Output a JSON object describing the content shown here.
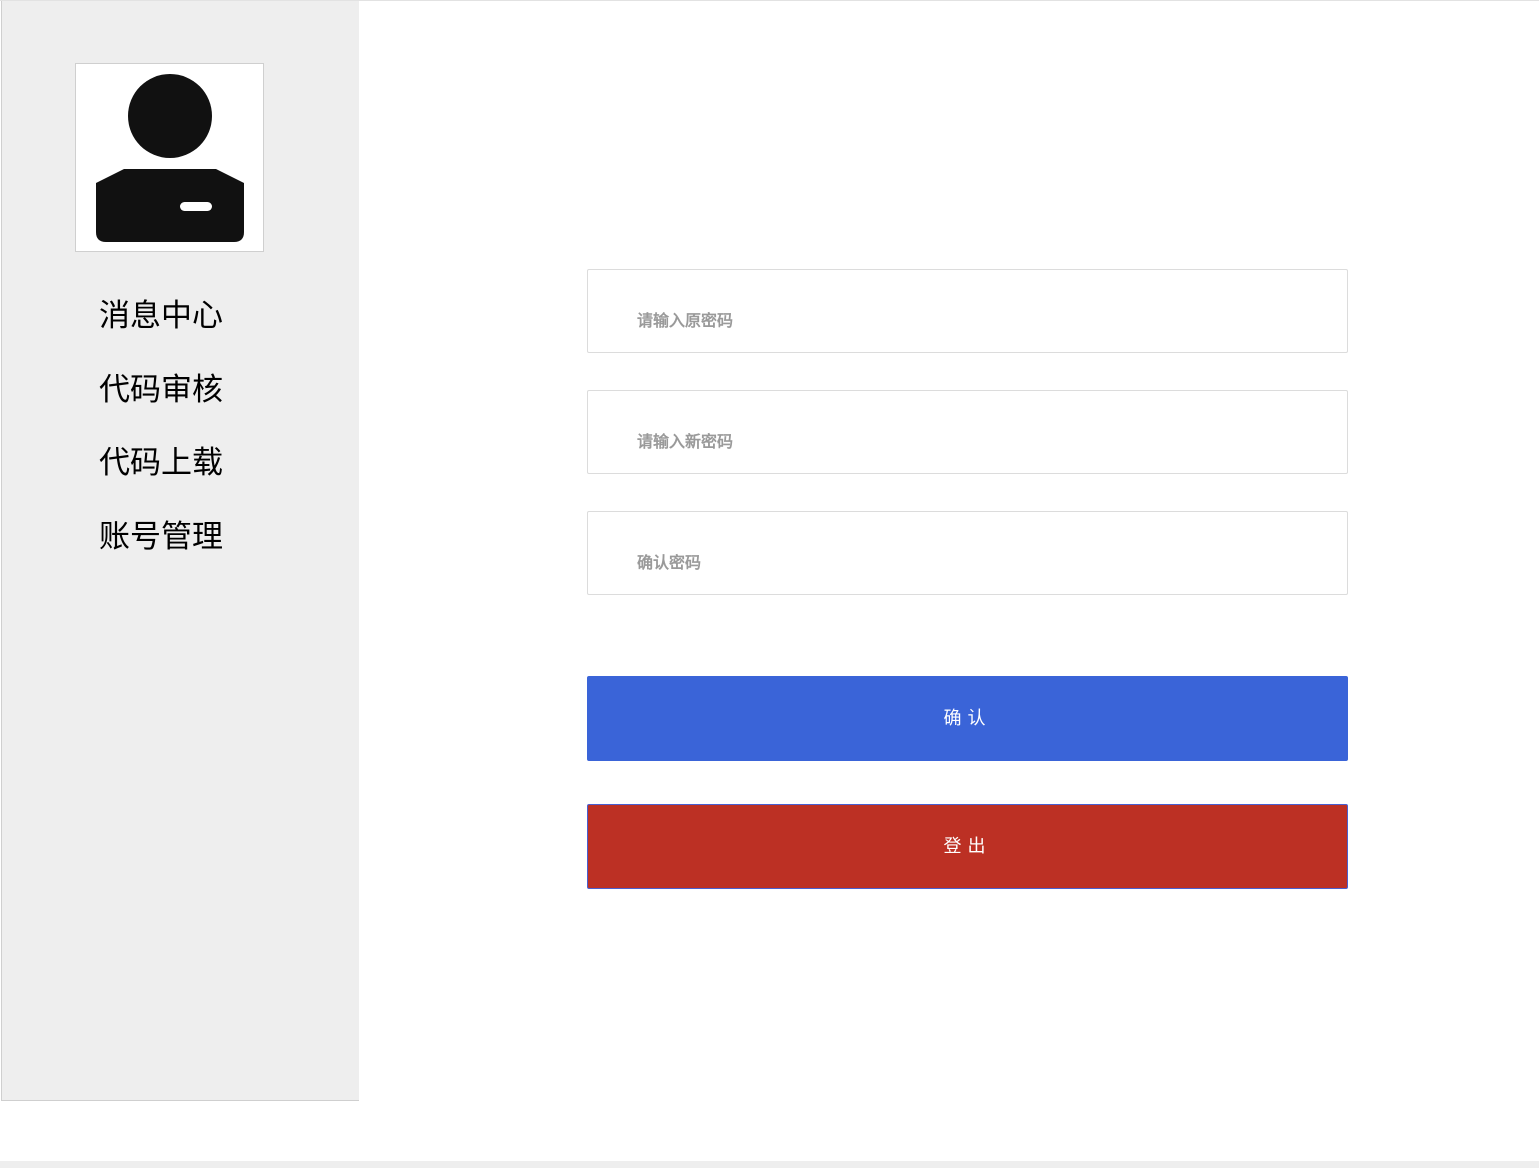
{
  "sidebar": {
    "avatar_icon": "user-avatar-icon",
    "items": [
      {
        "label": "消息中心"
      },
      {
        "label": "代码审核"
      },
      {
        "label": "代码上载"
      },
      {
        "label": "账号管理"
      }
    ]
  },
  "form": {
    "old_password": {
      "value": "",
      "placeholder": "请输入原密码"
    },
    "new_password": {
      "value": "",
      "placeholder": "请输入新密码"
    },
    "confirm_password": {
      "value": "",
      "placeholder": "确认密码"
    },
    "confirm_label": "确认",
    "logout_label": "登出"
  },
  "colors": {
    "sidebar_bg": "#eeeeee",
    "confirm_button": "#3a64d8",
    "logout_button": "#bc3024"
  }
}
